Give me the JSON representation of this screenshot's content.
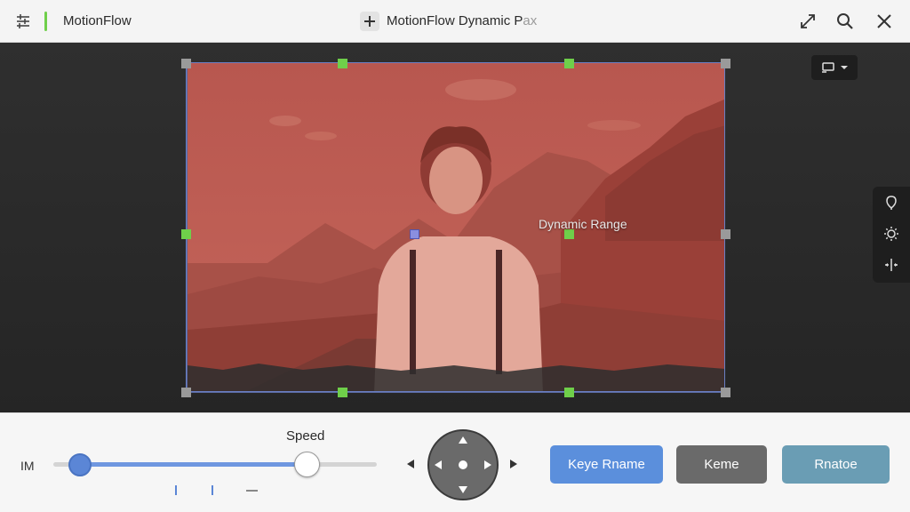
{
  "app": {
    "name": "MotionFlow",
    "title_main": "MotionFlow Dynamic P",
    "title_faded": "ax"
  },
  "canvas": {
    "overlay_label": "Dynamic Range"
  },
  "panel": {
    "im_label": "IM",
    "speed_label": "Speed",
    "slider": {
      "start_fraction": 0.08,
      "end_fraction": 0.78
    },
    "buttons": {
      "keyframe": "Keye Rname",
      "keme": "Keme",
      "hatoe": "Rnatoe"
    }
  },
  "colors": {
    "accent_green": "#6fcf4a",
    "primary_blue": "#5b8fdc",
    "overlay_red": "#c0453c",
    "teal": "#6a9db4",
    "gray_button": "#6a6a6a"
  },
  "icons": {
    "menu": "sliders-icon",
    "add": "plus-icon",
    "expand": "expand-icon",
    "search": "search-icon",
    "close": "close-icon",
    "display": "display-icon",
    "pin": "location-pin-icon",
    "brightness": "sun-icon",
    "split": "split-icon"
  }
}
